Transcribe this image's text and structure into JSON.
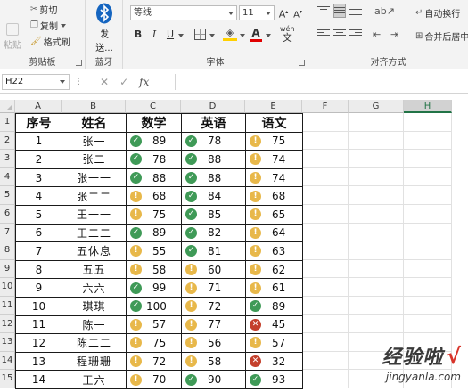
{
  "ribbon": {
    "clipboard": {
      "paste_label": "粘贴",
      "cut_label": "剪切",
      "copy_label": "复制",
      "format_painter_label": "格式刷",
      "group_label": "剪贴板"
    },
    "bluetooth": {
      "send_label": "发",
      "send_label2": "送...",
      "group_label": "蓝牙"
    },
    "font": {
      "font_name": "等线",
      "font_size": "11",
      "bold": "B",
      "italic": "I",
      "underline": "U",
      "pinyin": "wén",
      "group_label": "字体"
    },
    "alignment": {
      "wrap_label": "自动换行",
      "merge_label": "合并后居中",
      "group_label": "对齐方式"
    }
  },
  "formula_bar": {
    "name_box": "H22",
    "fx": "fx",
    "cancel": "✕",
    "confirm": "✓"
  },
  "columns": [
    "A",
    "B",
    "C",
    "D",
    "E",
    "F",
    "G",
    "H"
  ],
  "selected_column": "H",
  "rows": [
    "1",
    "2",
    "3",
    "4",
    "5",
    "6",
    "7",
    "8",
    "9",
    "10",
    "11",
    "12",
    "13",
    "14",
    "15"
  ],
  "table": {
    "headers": [
      "序号",
      "姓名",
      "数学",
      "英语",
      "语文"
    ],
    "records": [
      {
        "no": "1",
        "name": "张一",
        "math": "89",
        "math_icon": "ok",
        "eng": "78",
        "eng_icon": "ok",
        "chn": "75",
        "chn_icon": "warn"
      },
      {
        "no": "2",
        "name": "张二",
        "math": "78",
        "math_icon": "ok",
        "eng": "88",
        "eng_icon": "ok",
        "chn": "74",
        "chn_icon": "warn"
      },
      {
        "no": "3",
        "name": "张一一",
        "math": "88",
        "math_icon": "ok",
        "eng": "88",
        "eng_icon": "ok",
        "chn": "74",
        "chn_icon": "warn"
      },
      {
        "no": "4",
        "name": "张二二",
        "math": "68",
        "math_icon": "warn",
        "eng": "84",
        "eng_icon": "ok",
        "chn": "68",
        "chn_icon": "warn"
      },
      {
        "no": "5",
        "name": "王一一",
        "math": "75",
        "math_icon": "warn",
        "eng": "85",
        "eng_icon": "ok",
        "chn": "65",
        "chn_icon": "warn"
      },
      {
        "no": "6",
        "name": "王二二",
        "math": "89",
        "math_icon": "ok",
        "eng": "82",
        "eng_icon": "ok",
        "chn": "64",
        "chn_icon": "warn"
      },
      {
        "no": "7",
        "name": "五休息",
        "math": "55",
        "math_icon": "warn",
        "eng": "81",
        "eng_icon": "ok",
        "chn": "63",
        "chn_icon": "warn"
      },
      {
        "no": "8",
        "name": "五五",
        "math": "58",
        "math_icon": "warn",
        "eng": "60",
        "eng_icon": "warn",
        "chn": "62",
        "chn_icon": "warn"
      },
      {
        "no": "9",
        "name": "六六",
        "math": "99",
        "math_icon": "ok",
        "eng": "71",
        "eng_icon": "warn",
        "chn": "61",
        "chn_icon": "warn"
      },
      {
        "no": "10",
        "name": "琪琪",
        "math": "100",
        "math_icon": "ok",
        "eng": "72",
        "eng_icon": "warn",
        "chn": "89",
        "chn_icon": "ok"
      },
      {
        "no": "11",
        "name": "陈一",
        "math": "57",
        "math_icon": "warn",
        "eng": "77",
        "eng_icon": "warn",
        "chn": "45",
        "chn_icon": "bad"
      },
      {
        "no": "12",
        "name": "陈二二",
        "math": "75",
        "math_icon": "warn",
        "eng": "56",
        "eng_icon": "warn",
        "chn": "57",
        "chn_icon": "warn"
      },
      {
        "no": "13",
        "name": "程珊珊",
        "math": "72",
        "math_icon": "warn",
        "eng": "58",
        "eng_icon": "warn",
        "chn": "32",
        "chn_icon": "bad"
      },
      {
        "no": "14",
        "name": "王六",
        "math": "70",
        "math_icon": "warn",
        "eng": "90",
        "eng_icon": "ok",
        "chn": "93",
        "chn_icon": "ok"
      }
    ]
  },
  "icon_glyphs": {
    "ok": "✓",
    "warn": "!",
    "bad": "✕"
  },
  "colors": {
    "ok": "#3f9a57",
    "warn": "#e8b84a",
    "bad": "#c4402c",
    "accent": "#217346"
  },
  "watermark": {
    "cn": "经验啦",
    "check": "√",
    "url": "jingyanla.com"
  }
}
